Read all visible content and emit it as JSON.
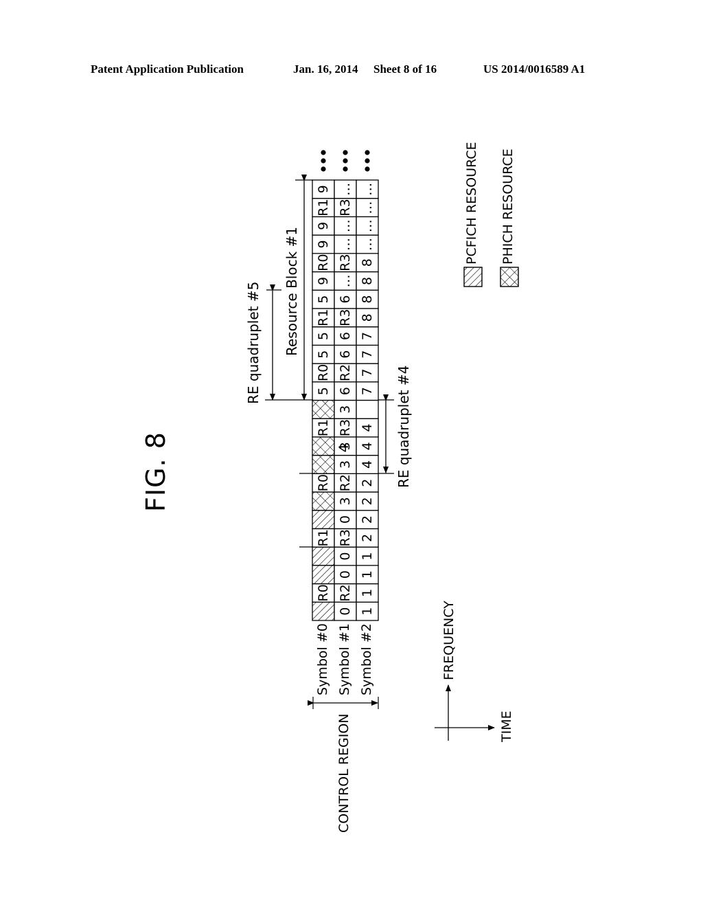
{
  "header": {
    "left": "Patent Application Publication",
    "date": "Jan. 16, 2014",
    "sheet": "Sheet 8 of 16",
    "number": "US 2014/0016589 A1"
  },
  "figure": {
    "title": "FIG. 8",
    "control_region_label": "CONTROL REGION",
    "symbols": [
      "Symbol #0",
      "Symbol #1",
      "Symbol #2"
    ],
    "annotations": {
      "re_quadruplet_5": "RE quadruplet #5",
      "resource_block_1": "Resource Block #1",
      "re_quadruplet_4": "RE quadruplet #4"
    },
    "axes": {
      "frequency": "FREQUENCY",
      "time": "TIME"
    },
    "legend": [
      {
        "pattern": "hatch",
        "label": "PCFICH RESOURCE"
      },
      {
        "pattern": "crosshatch",
        "label": "PHICH RESOURCE"
      }
    ],
    "continuation": "•••",
    "grid": [
      [
        "#H",
        "R0",
        "#H",
        "#H",
        "R1",
        "#H",
        "#X",
        "R0",
        "#X",
        "#X",
        "R1",
        "#X",
        "5",
        "R0",
        "5",
        "5",
        "R1",
        "5",
        "9",
        "R0",
        "9",
        "9",
        "R1",
        "9"
      ],
      [
        "0",
        "R2",
        "0",
        "0",
        "R3",
        "0",
        "3",
        "R2",
        "3",
        "3",
        "R3",
        "3",
        "6",
        "R2",
        "6",
        "6",
        "R3",
        "6",
        "…",
        "R3",
        "…",
        "…",
        "R3",
        "…"
      ],
      [
        "1",
        "1",
        "1",
        "1",
        "2",
        "2",
        "2",
        "2",
        "4",
        "4",
        "4",
        "",
        "7",
        "7",
        "7",
        "7",
        "8",
        "8",
        "8",
        "8",
        "…",
        "…",
        "…",
        "…"
      ]
    ],
    "overlap_cell": {
      "row": 1,
      "index": 9,
      "extra": "4"
    }
  }
}
